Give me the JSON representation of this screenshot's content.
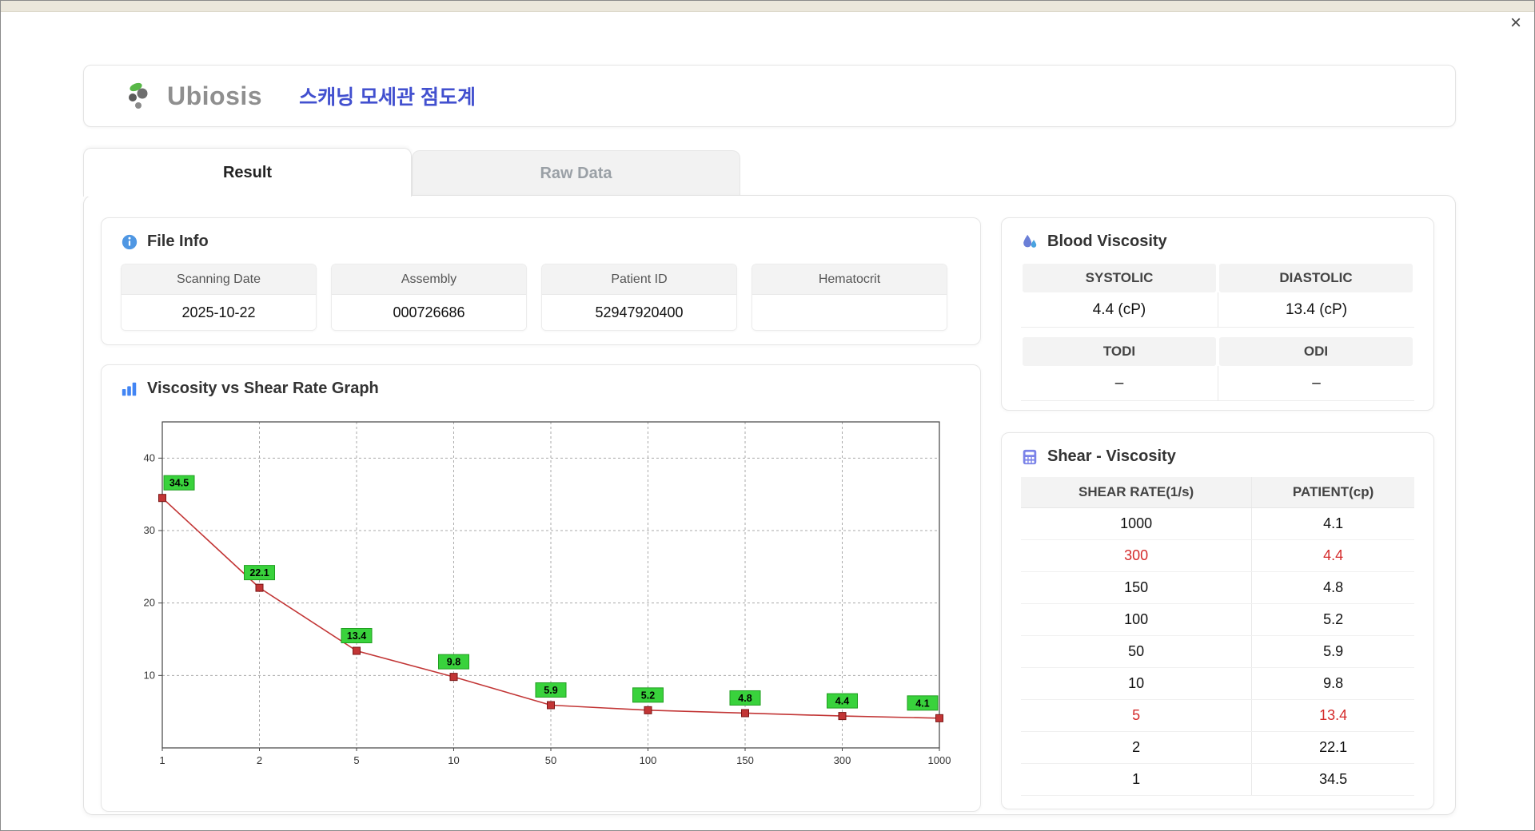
{
  "window": {
    "close_glyph": "×"
  },
  "header": {
    "brand": "Ubiosis",
    "title": "스캐닝 모세관 점도계"
  },
  "tabs": [
    {
      "label": "Result"
    },
    {
      "label": "Raw Data"
    }
  ],
  "file_info": {
    "title": "File Info",
    "fields": [
      {
        "label": "Scanning Date",
        "value": "2025-10-22"
      },
      {
        "label": "Assembly",
        "value": "000726686"
      },
      {
        "label": "Patient ID",
        "value": "52947920400"
      },
      {
        "label": "Hematocrit",
        "value": ""
      }
    ]
  },
  "graph": {
    "title": "Viscosity vs Shear Rate Graph"
  },
  "chart_data": {
    "type": "line",
    "title": "Viscosity vs Shear Rate Graph",
    "x": [
      1,
      2,
      5,
      10,
      50,
      100,
      150,
      300,
      1000
    ],
    "x_tick_labels": [
      "1",
      "2",
      "5",
      "10",
      "50",
      "100",
      "150",
      "300",
      "1000"
    ],
    "x_scale": "categorical",
    "values": [
      34.5,
      22.1,
      13.4,
      9.8,
      5.9,
      5.2,
      4.8,
      4.4,
      4.1
    ],
    "y_ticks": [
      10,
      20,
      30,
      40
    ],
    "ylim": [
      0,
      45
    ],
    "grid": "dashed",
    "series_color": "#c23535",
    "marker": "square",
    "point_label_bg": "#39d23c",
    "point_label_border": "#1f9e1f"
  },
  "blood_viscosity": {
    "title": "Blood Viscosity",
    "rows": [
      {
        "headers": [
          "SYSTOLIC",
          "DIASTOLIC"
        ],
        "values": [
          "4.4 (cP)",
          "13.4 (cP)"
        ]
      },
      {
        "headers": [
          "TODI",
          "ODI"
        ],
        "values": [
          "–",
          "–"
        ]
      }
    ]
  },
  "shear_viscosity": {
    "title": "Shear - Viscosity",
    "columns": [
      "SHEAR RATE(1/s)",
      "PATIENT(cp)"
    ],
    "highlight_color": "#d42a2a",
    "rows": [
      {
        "rate": "1000",
        "patient": "4.1",
        "highlight": false
      },
      {
        "rate": "300",
        "patient": "4.4",
        "highlight": true
      },
      {
        "rate": "150",
        "patient": "4.8",
        "highlight": false
      },
      {
        "rate": "100",
        "patient": "5.2",
        "highlight": false
      },
      {
        "rate": "50",
        "patient": "5.9",
        "highlight": false
      },
      {
        "rate": "10",
        "patient": "9.8",
        "highlight": false
      },
      {
        "rate": "5",
        "patient": "13.4",
        "highlight": true
      },
      {
        "rate": "2",
        "patient": "22.1",
        "highlight": false
      },
      {
        "rate": "1",
        "patient": "34.5",
        "highlight": false
      }
    ]
  }
}
